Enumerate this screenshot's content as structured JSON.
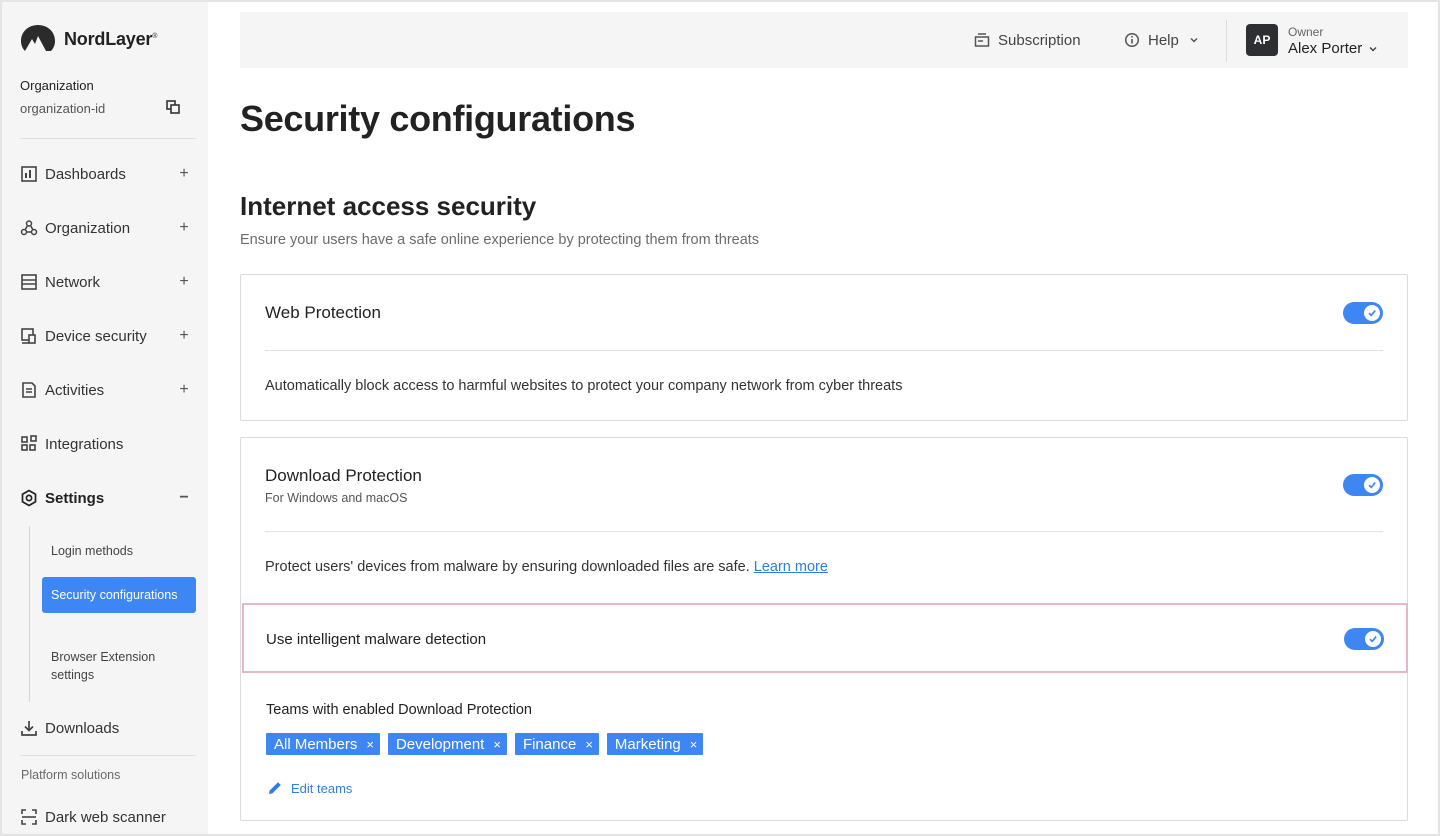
{
  "brand": {
    "name": "NordLayer",
    "reg": "®"
  },
  "sidebar": {
    "org_label": "Organization",
    "org_id": "organization-id",
    "nav": [
      {
        "label": "Dashboards",
        "expander": "+",
        "icon": "dashboard-icon"
      },
      {
        "label": "Organization",
        "expander": "+",
        "icon": "organization-icon"
      },
      {
        "label": "Network",
        "expander": "+",
        "icon": "network-icon"
      },
      {
        "label": "Device security",
        "expander": "+",
        "icon": "device-security-icon"
      },
      {
        "label": "Activities",
        "expander": "+",
        "icon": "activities-icon"
      },
      {
        "label": "Integrations",
        "icon": "integrations-icon"
      },
      {
        "label": "Settings",
        "expander": "−",
        "icon": "settings-icon"
      }
    ],
    "settings_sub": [
      {
        "label": "Login methods"
      },
      {
        "label": "Security configurations",
        "active": true
      },
      {
        "label": "Browser Extension settings"
      }
    ],
    "downloads": "Downloads",
    "platform_label": "Platform solutions",
    "dark_web": "Dark web scanner"
  },
  "topbar": {
    "subscription": "Subscription",
    "help": "Help",
    "avatar_initials": "AP",
    "role": "Owner",
    "user_name": "Alex Porter"
  },
  "page": {
    "title": "Security configurations",
    "section_title": "Internet access security",
    "section_desc": "Ensure your users have a safe online experience by protecting them from threats"
  },
  "web_protection": {
    "title": "Web Protection",
    "enabled": true,
    "description": "Automatically block access to harmful websites to protect your company network from cyber threats"
  },
  "download_protection": {
    "title": "Download Protection",
    "subtitle": "For Windows and macOS",
    "enabled": true,
    "description": "Protect users' devices from malware by ensuring downloaded files are safe.",
    "learn_more": "Learn more",
    "malware_detection_label": "Use intelligent malware detection",
    "malware_detection_enabled": true,
    "teams_label": "Teams with enabled Download Protection",
    "teams": [
      "All Members",
      "Development",
      "Finance",
      "Marketing"
    ],
    "chip_remove": "×",
    "edit_teams": "Edit teams"
  },
  "colors": {
    "accent": "#3e86f3",
    "link": "#2f7ee6",
    "highlight_border": "#e7b7c8",
    "sidebar_bg": "#f5f5f5"
  }
}
